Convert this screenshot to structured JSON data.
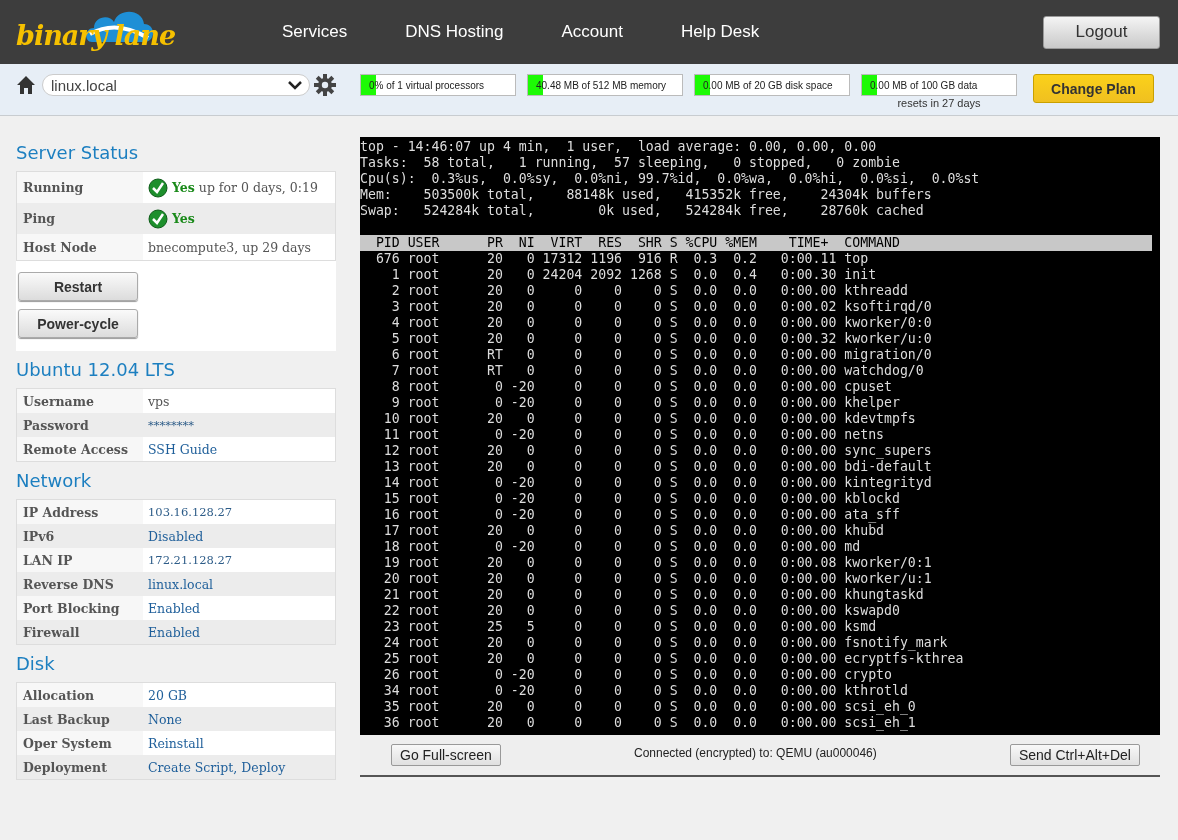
{
  "header": {
    "logo": "binary lane",
    "nav": [
      {
        "label": "Services"
      },
      {
        "label": "DNS Hosting"
      },
      {
        "label": "Account"
      },
      {
        "label": "Help Desk"
      }
    ],
    "logout": "Logout"
  },
  "toolbar": {
    "server_select": "linux.local",
    "meters": [
      {
        "text": "0% of 1 virtual processors",
        "level": 0.1
      },
      {
        "text": "40.48 MB of 512 MB memory",
        "level": 0.1
      },
      {
        "text": "0.00 MB of 20 GB disk space",
        "level": 0.1
      },
      {
        "text": "0.00 MB of 100 GB data",
        "level": 0.1,
        "note": "resets in 27 days"
      }
    ],
    "change_plan": "Change Plan"
  },
  "sections": [
    {
      "title": "Server Status",
      "rows": [
        {
          "kind": "status",
          "label": "Running",
          "status": "Yes",
          "detail": "up for 0 days, 0:19"
        },
        {
          "kind": "status",
          "label": "Ping",
          "status": "Yes"
        },
        {
          "kind": "text",
          "label": "Host Node",
          "value": "bnecompute3, up 29 days"
        }
      ],
      "buttons": [
        "Restart",
        "Power-cycle"
      ]
    },
    {
      "title": "Ubuntu 12.04 LTS",
      "rows": [
        {
          "kind": "text",
          "label": "Username",
          "value": "vps"
        },
        {
          "kind": "secret",
          "label": "Password",
          "value": "********"
        },
        {
          "kind": "link",
          "label": "Remote Access",
          "value": "SSH Guide"
        }
      ]
    },
    {
      "title": "Network",
      "rows": [
        {
          "kind": "secret",
          "label": "IP Address",
          "value": "103.16.128.27"
        },
        {
          "kind": "link",
          "label": "IPv6",
          "value": "Disabled"
        },
        {
          "kind": "secret",
          "label": "LAN IP",
          "value": "172.21.128.27"
        },
        {
          "kind": "link",
          "label": "Reverse DNS",
          "value": "linux.local"
        },
        {
          "kind": "link",
          "label": "Port Blocking",
          "value": "Enabled"
        },
        {
          "kind": "link",
          "label": "Firewall",
          "value": "Enabled"
        }
      ]
    },
    {
      "title": "Disk",
      "rows": [
        {
          "kind": "link",
          "label": "Allocation",
          "value": "20 GB"
        },
        {
          "kind": "link",
          "label": "Last Backup",
          "value": "None"
        },
        {
          "kind": "link",
          "label": "Oper System",
          "value": "Reinstall"
        },
        {
          "kind": "link",
          "label": "Deployment",
          "value": "Create Script, Deploy"
        }
      ]
    }
  ],
  "console": {
    "summary": [
      "top - 14:46:07 up 4 min,  1 user,  load average: 0.00, 0.00, 0.00",
      "Tasks:  58 total,   1 running,  57 sleeping,   0 stopped,   0 zombie",
      "Cpu(s):  0.3%us,  0.0%sy,  0.0%ni, 99.7%id,  0.0%wa,  0.0%hi,  0.0%si,  0.0%st",
      "Mem:    503500k total,    88148k used,   415352k free,    24304k buffers",
      "Swap:   524284k total,        0k used,   524284k free,    28760k cached"
    ],
    "columns": "  PID USER      PR  NI  VIRT  RES  SHR S %CPU %MEM    TIME+  COMMAND",
    "processes": [
      "  676 root      20   0 17312 1196  916 R  0.3  0.2   0:00.11 top",
      "    1 root      20   0 24204 2092 1268 S  0.0  0.4   0:00.30 init",
      "    2 root      20   0     0    0    0 S  0.0  0.0   0:00.00 kthreadd",
      "    3 root      20   0     0    0    0 S  0.0  0.0   0:00.02 ksoftirqd/0",
      "    4 root      20   0     0    0    0 S  0.0  0.0   0:00.00 kworker/0:0",
      "    5 root      20   0     0    0    0 S  0.0  0.0   0:00.32 kworker/u:0",
      "    6 root      RT   0     0    0    0 S  0.0  0.0   0:00.00 migration/0",
      "    7 root      RT   0     0    0    0 S  0.0  0.0   0:00.00 watchdog/0",
      "    8 root       0 -20     0    0    0 S  0.0  0.0   0:00.00 cpuset",
      "    9 root       0 -20     0    0    0 S  0.0  0.0   0:00.00 khelper",
      "   10 root      20   0     0    0    0 S  0.0  0.0   0:00.00 kdevtmpfs",
      "   11 root       0 -20     0    0    0 S  0.0  0.0   0:00.00 netns",
      "   12 root      20   0     0    0    0 S  0.0  0.0   0:00.00 sync_supers",
      "   13 root      20   0     0    0    0 S  0.0  0.0   0:00.00 bdi-default",
      "   14 root       0 -20     0    0    0 S  0.0  0.0   0:00.00 kintegrityd",
      "   15 root       0 -20     0    0    0 S  0.0  0.0   0:00.00 kblockd",
      "   16 root       0 -20     0    0    0 S  0.0  0.0   0:00.00 ata_sff",
      "   17 root      20   0     0    0    0 S  0.0  0.0   0:00.00 khubd",
      "   18 root       0 -20     0    0    0 S  0.0  0.0   0:00.00 md",
      "   19 root      20   0     0    0    0 S  0.0  0.0   0:00.08 kworker/0:1",
      "   20 root      20   0     0    0    0 S  0.0  0.0   0:00.00 kworker/u:1",
      "   21 root      20   0     0    0    0 S  0.0  0.0   0:00.00 khungtaskd",
      "   22 root      20   0     0    0    0 S  0.0  0.0   0:00.00 kswapd0",
      "   23 root      25   5     0    0    0 S  0.0  0.0   0:00.00 ksmd",
      "   24 root      20   0     0    0    0 S  0.0  0.0   0:00.00 fsnotify_mark",
      "   25 root      20   0     0    0    0 S  0.0  0.0   0:00.00 ecryptfs-kthrea",
      "   26 root       0 -20     0    0    0 S  0.0  0.0   0:00.00 crypto",
      "   34 root       0 -20     0    0    0 S  0.0  0.0   0:00.00 kthrotld",
      "   35 root      20   0     0    0    0 S  0.0  0.0   0:00.00 scsi_eh_0",
      "   36 root      20   0     0    0    0 S  0.0  0.0   0:00.00 scsi_eh_1"
    ],
    "fullscreen": "Go Full-screen",
    "connection": "Connected (encrypted) to: QEMU (au000046)",
    "send_keys": "Send Ctrl+Alt+Del"
  }
}
